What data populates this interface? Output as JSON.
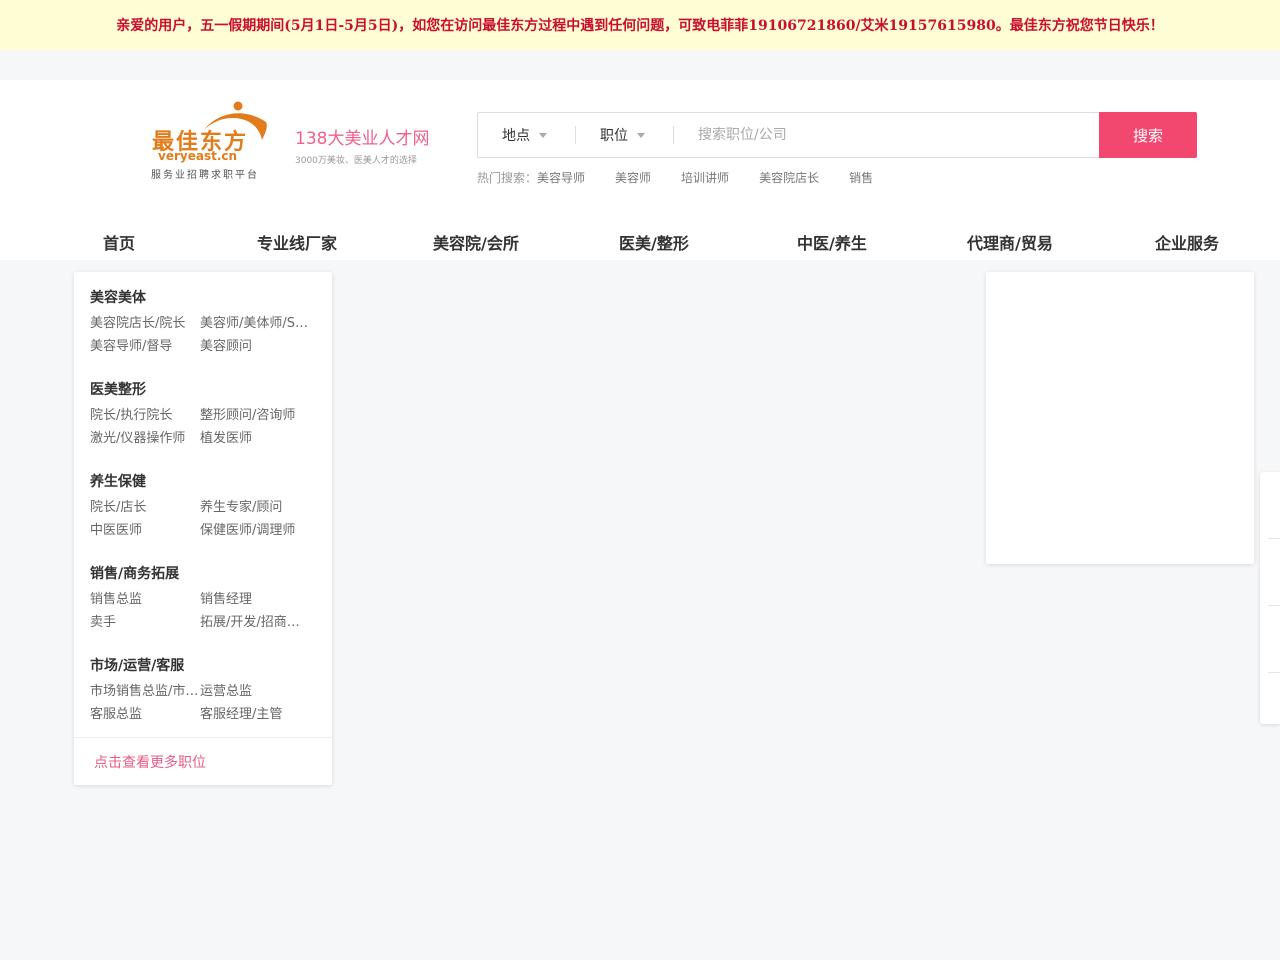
{
  "notice": {
    "text": "亲爱的用户，五一假期期间(5月1日-5月5日)，如您在访问最佳东方过程中遇到任何问题，可致电菲菲19106721860/艾米19157615980。最佳东方祝您节日快乐！"
  },
  "logo": {
    "brand_cn": "最佳东方",
    "brand_en": "veryeast.cn",
    "slogan": "服务业招聘求职平台"
  },
  "site_tag": {
    "title": "138大美业人才网",
    "subtitle": "3000万美妆、医美人才的选择"
  },
  "search": {
    "location_label": "地点",
    "position_label": "职位",
    "placeholder": "搜索职位/公司",
    "value": "",
    "button_label": "搜索"
  },
  "hot_search": {
    "label": "热门搜索：",
    "items": [
      "美容导师",
      "美容师",
      "培训讲师",
      "美容院店长",
      "销售"
    ]
  },
  "nav": [
    "首页",
    "专业线厂家",
    "美容院/会所",
    "医美/整形",
    "中医/养生",
    "代理商/贸易",
    "企业服务"
  ],
  "menu": {
    "categories": [
      {
        "title": "美容美体",
        "items": [
          "美容院店长/院长",
          "美容师/美体师/SPA技师",
          "美容导师/督导",
          "美容顾问"
        ]
      },
      {
        "title": "医美整形",
        "items": [
          "院长/执行院长",
          "整形顾问/咨询师",
          "激光/仪器操作师",
          "植发医师"
        ]
      },
      {
        "title": "养生保健",
        "items": [
          "院长/店长",
          "养生专家/顾问",
          "中医医师",
          "保健医师/调理师"
        ]
      },
      {
        "title": "销售/商务拓展",
        "items": [
          "销售总监",
          "销售经理",
          "卖手",
          "拓展/开发/招商经理"
        ]
      },
      {
        "title": "市场/运营/客服",
        "items": [
          "市场销售总监/市场经理",
          "运营总监",
          "客服总监",
          "客服经理/主管"
        ]
      }
    ],
    "more_label": "点击查看更多职位"
  },
  "colors": {
    "accent": "#f2476e",
    "brand": "#e27b1a",
    "notice_text": "#c8102e",
    "notice_bg": "#fffdd3"
  }
}
